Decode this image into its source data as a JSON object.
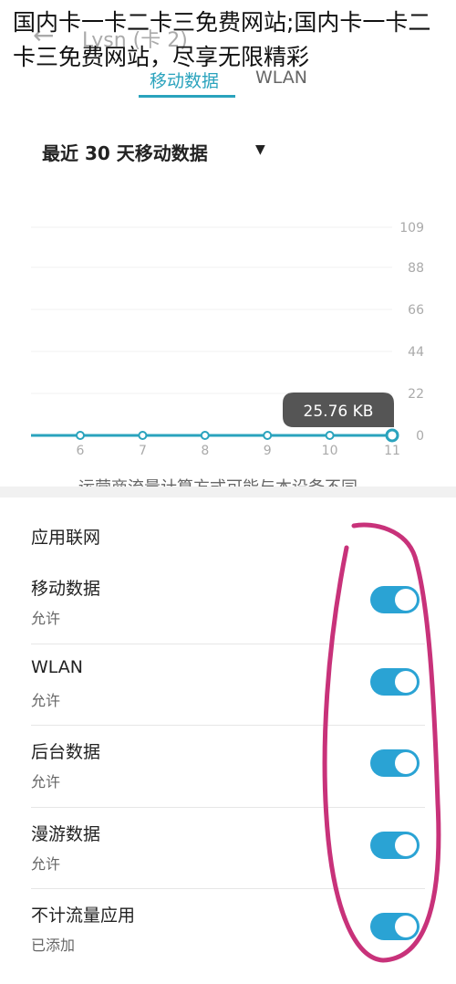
{
  "overlay_title": "国内卡一卡二卡三免费网站;国内卡一卡二卡三免费网站，尽享无限精彩",
  "appbar": {
    "back_icon": "arrow-left-icon",
    "title": "Lysn (卡 2)"
  },
  "tabs": [
    {
      "label": "移动数据",
      "active": true
    },
    {
      "label": "WLAN",
      "active": false
    }
  ],
  "range_selector": {
    "value": "最近 30 天移动数据",
    "icon": "caret-down-icon"
  },
  "chart_data": {
    "type": "line",
    "x": [
      6,
      7,
      8,
      9,
      10,
      11
    ],
    "values": [
      0,
      0,
      0,
      0,
      0,
      0.025
    ],
    "yticks": [
      0,
      22,
      44,
      66,
      88,
      109
    ],
    "ylim": [
      0,
      109
    ],
    "xlabel": "",
    "ylabel": "",
    "grid": true,
    "tooltip": "25.76 KB",
    "color": "#2aa3bd"
  },
  "note": "运营商流量计算方式可能与本设备不同",
  "section_title": "应用联网",
  "settings": [
    {
      "title": "移动数据",
      "subtitle": "允许",
      "enabled": true
    },
    {
      "title": "WLAN",
      "subtitle": "允许",
      "enabled": true
    },
    {
      "title": "后台数据",
      "subtitle": "允许",
      "enabled": true
    },
    {
      "title": "漫游数据",
      "subtitle": "允许",
      "enabled": true
    },
    {
      "title": "不计流量应用",
      "subtitle": "已添加",
      "enabled": true
    }
  ],
  "colors": {
    "accent": "#2aa3bd",
    "toggle": "#2aa3d4",
    "annotation": "#c8327a"
  }
}
